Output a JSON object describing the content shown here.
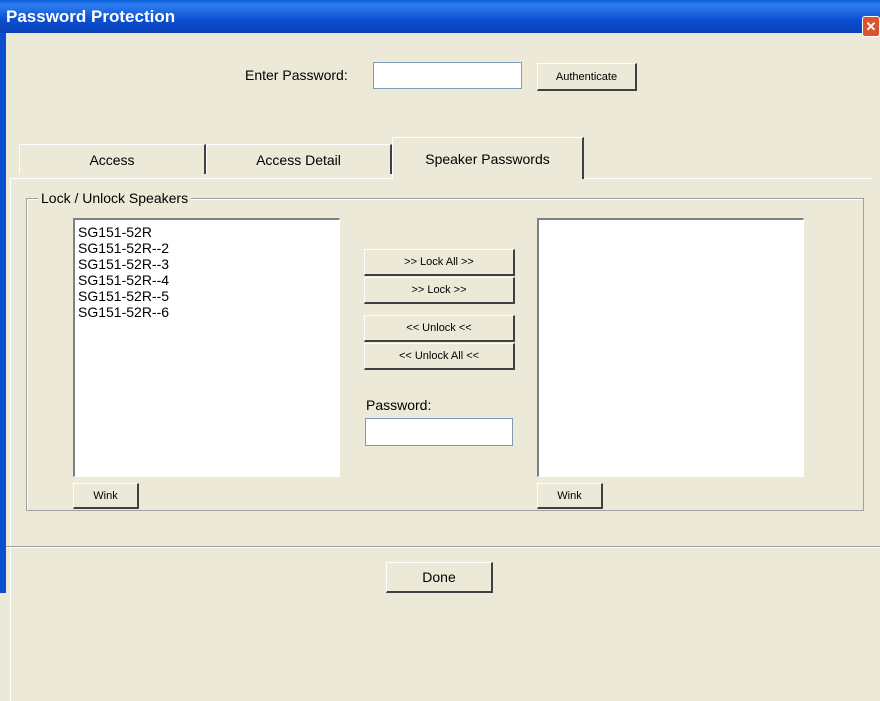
{
  "window": {
    "title": "Password Protection",
    "close_glyph": "✕"
  },
  "auth": {
    "label": "Enter Password:",
    "value": "",
    "button": "Authenticate"
  },
  "tabs": [
    "Access",
    "Access Detail",
    "Speaker Passwords"
  ],
  "group": {
    "title": "Lock / Unlock Speakers",
    "unlocked_list": [
      "SG151-52R",
      "SG151-52R--2",
      "SG151-52R--3",
      "SG151-52R--4",
      "SG151-52R--5",
      "SG151-52R--6"
    ],
    "locked_list": [],
    "buttons": {
      "lock_all": ">> Lock All >>",
      "lock": ">> Lock >>",
      "unlock": "<< Unlock <<",
      "unlock_all": "<< Unlock All <<"
    },
    "password_label": "Password:",
    "password_value": "",
    "wink_left": "Wink",
    "wink_right": "Wink"
  },
  "footer": {
    "done": "Done"
  },
  "colors": {
    "titlebar": "#0a4fd0",
    "face": "#ece9d8"
  }
}
